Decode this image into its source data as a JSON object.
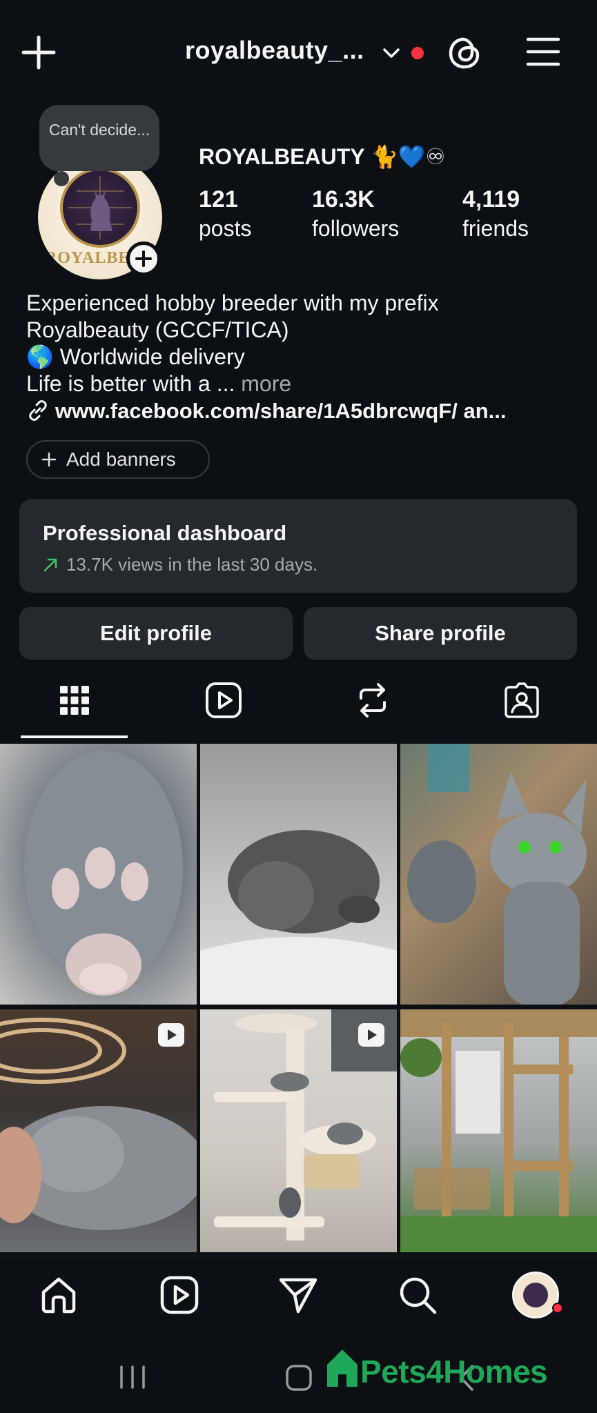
{
  "header": {
    "username": "royalbeauty_...",
    "icons": [
      "plus-icon",
      "chevron-down-icon",
      "notification-dot",
      "threads-icon",
      "menu-icon"
    ]
  },
  "profile": {
    "note": "Can't decide...",
    "avatar_text": "ROYALBEAU",
    "display_name": "ROYALBEAUTY 🐈💙♾",
    "stats": [
      {
        "value": "121",
        "label": "posts"
      },
      {
        "value": "16.3K",
        "label": "followers"
      },
      {
        "value": "4,119",
        "label": "friends"
      }
    ],
    "bio_lines": [
      "Experienced hobby breeder with my prefix",
      "Royalbeauty (GCCF/TICA)",
      "🌎 Worldwide delivery",
      "Life is better with a ..."
    ],
    "bio_more": "more",
    "link": "www.facebook.com/share/1A5dbrcwqF/ an..."
  },
  "add_banners_label": "Add banners",
  "dashboard": {
    "title": "Professional dashboard",
    "subtitle": "13.7K views in the last 30 days."
  },
  "buttons": {
    "edit": "Edit profile",
    "share": "Share profile"
  },
  "tabs": [
    "grid-icon",
    "reels-icon",
    "reposts-icon",
    "tagged-icon"
  ],
  "posts": [
    {
      "subject": "paw",
      "is_reel": false
    },
    {
      "subject": "kitten",
      "is_reel": false
    },
    {
      "subject": "cat-green-eyes",
      "is_reel": false
    },
    {
      "subject": "cat-sleeping",
      "is_reel": true
    },
    {
      "subject": "cat-tree",
      "is_reel": true
    },
    {
      "subject": "cat-enclosure",
      "is_reel": false
    }
  ],
  "bottom_nav": [
    "home-icon",
    "reels-icon",
    "direct-icon",
    "search-icon",
    "profile-avatar"
  ],
  "watermark": "Pets4Homes",
  "colors": {
    "background": "#0c1014",
    "card": "#25292e",
    "accent_red": "#ff3040",
    "trend_green": "#3ec46d",
    "watermark_green": "#1fa75a"
  }
}
